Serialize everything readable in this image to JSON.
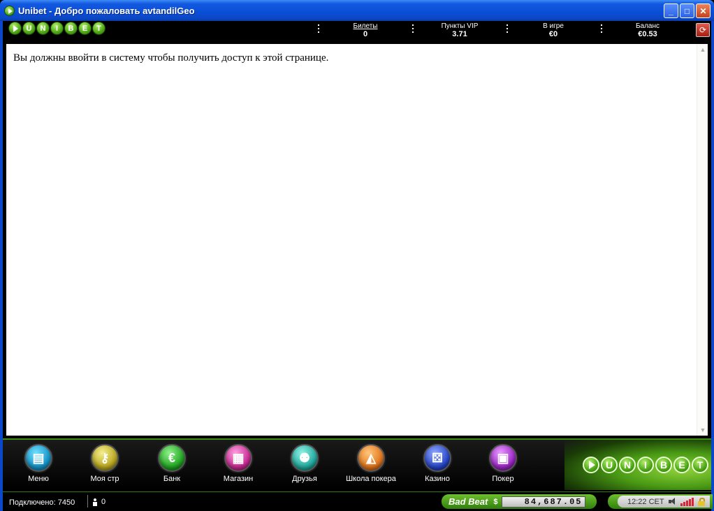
{
  "window": {
    "title": "Unibet - Добро пожаловать avtandilGeo",
    "minimize_label": "_",
    "maximize_label": "□",
    "close_label": "✕"
  },
  "header": {
    "logo_letters": [
      "U",
      "N",
      "I",
      "B",
      "E",
      "T"
    ],
    "stats": [
      {
        "label": "Билеты",
        "value": "0"
      },
      {
        "label": "Пункты VIP",
        "value": "3.71"
      },
      {
        "label": "В игре",
        "value": "€0"
      },
      {
        "label": "Баланс",
        "value": "€0.53"
      }
    ],
    "refresh_label": "⟳"
  },
  "content": {
    "message": "Вы должны ввойти в систему чтобы получить доступ к этой странице."
  },
  "nav": {
    "items": [
      {
        "label": "Меню",
        "icon": "menu-icon",
        "glyph": "▤"
      },
      {
        "label": "Моя стр",
        "icon": "key-icon",
        "glyph": "⚷"
      },
      {
        "label": "Банк",
        "icon": "euro-icon",
        "glyph": "€"
      },
      {
        "label": "Магазин",
        "icon": "gift-icon",
        "glyph": "▦"
      },
      {
        "label": "Друзья",
        "icon": "friends-icon",
        "glyph": "⚉"
      },
      {
        "label": "Школа покера",
        "icon": "graduation-cap-icon",
        "glyph": "◭"
      },
      {
        "label": "Казино",
        "icon": "dice-icon",
        "glyph": "⚄"
      },
      {
        "label": "Покер",
        "icon": "poker-icon",
        "glyph": "▣"
      }
    ],
    "logo_letters": [
      "U",
      "N",
      "I",
      "B",
      "E",
      "T"
    ]
  },
  "status": {
    "connected": "Подключено: 7450",
    "players": "0",
    "badbeat_title": "Bad Beat",
    "badbeat_currency": "$",
    "badbeat_amount": "84,687.05",
    "time": "12:22 CET"
  },
  "colors": {
    "brand_green": "#4ca614",
    "xp_blue": "#0b48c9",
    "background": "#000000"
  }
}
